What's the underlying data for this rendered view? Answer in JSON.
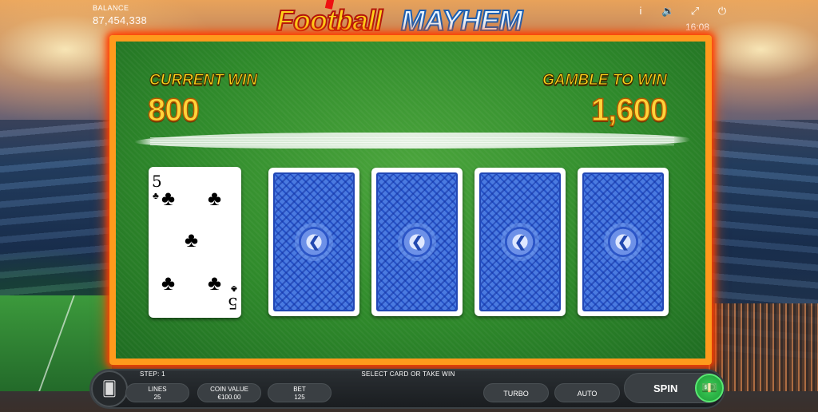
{
  "header": {
    "balance_label": "BALANCE",
    "balance_value": "87,454,338",
    "logo_word1": "Football",
    "logo_word2": "MAYHEM",
    "clock": "16:08",
    "icons": [
      "info-icon",
      "sound-icon",
      "fullscreen-icon",
      "power-icon"
    ]
  },
  "gamble": {
    "current_win_label": "CURRENT WIN",
    "current_win_value": "800",
    "gamble_to_win_label": "GAMBLE TO WIN",
    "gamble_to_win_value": "1,600",
    "dealer_card": {
      "rank": "5",
      "suit": "clubs",
      "suit_symbol": "♣",
      "face_up": true
    },
    "pick_cards": [
      {
        "face_up": false
      },
      {
        "face_up": false
      },
      {
        "face_up": false
      },
      {
        "face_up": false
      }
    ]
  },
  "footer": {
    "step_text": "STEP: 1",
    "message": "SELECT CARD OR TAKE WIN",
    "lines_label": "LINES",
    "lines_value": "25",
    "coin_value_label": "COIN VALUE",
    "coin_value_value": "€100.00",
    "bet_label": "BET",
    "bet_value": "125",
    "turbo_label": "TURBO",
    "auto_label": "AUTO",
    "spin_label": "SPIN"
  },
  "colors": {
    "felt_green": "#2f8a2b",
    "frame_orange": "#ff9a1c",
    "win_text_gold": "#ffd21a",
    "card_back_blue": "#2552c8",
    "collect_green": "#1c9a35"
  }
}
